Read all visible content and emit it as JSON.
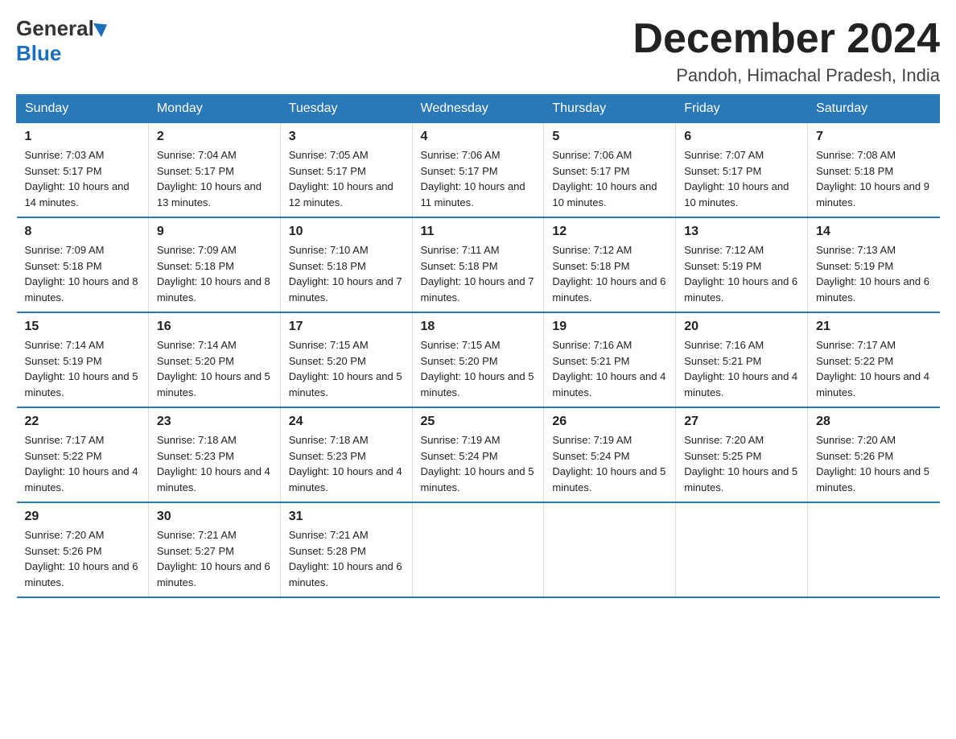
{
  "logo": {
    "general": "General",
    "blue": "Blue"
  },
  "title": "December 2024",
  "subtitle": "Pandoh, Himachal Pradesh, India",
  "days_of_week": [
    "Sunday",
    "Monday",
    "Tuesday",
    "Wednesday",
    "Thursday",
    "Friday",
    "Saturday"
  ],
  "weeks": [
    [
      {
        "date": "1",
        "sunrise": "Sunrise: 7:03 AM",
        "sunset": "Sunset: 5:17 PM",
        "daylight": "Daylight: 10 hours and 14 minutes."
      },
      {
        "date": "2",
        "sunrise": "Sunrise: 7:04 AM",
        "sunset": "Sunset: 5:17 PM",
        "daylight": "Daylight: 10 hours and 13 minutes."
      },
      {
        "date": "3",
        "sunrise": "Sunrise: 7:05 AM",
        "sunset": "Sunset: 5:17 PM",
        "daylight": "Daylight: 10 hours and 12 minutes."
      },
      {
        "date": "4",
        "sunrise": "Sunrise: 7:06 AM",
        "sunset": "Sunset: 5:17 PM",
        "daylight": "Daylight: 10 hours and 11 minutes."
      },
      {
        "date": "5",
        "sunrise": "Sunrise: 7:06 AM",
        "sunset": "Sunset: 5:17 PM",
        "daylight": "Daylight: 10 hours and 10 minutes."
      },
      {
        "date": "6",
        "sunrise": "Sunrise: 7:07 AM",
        "sunset": "Sunset: 5:17 PM",
        "daylight": "Daylight: 10 hours and 10 minutes."
      },
      {
        "date": "7",
        "sunrise": "Sunrise: 7:08 AM",
        "sunset": "Sunset: 5:18 PM",
        "daylight": "Daylight: 10 hours and 9 minutes."
      }
    ],
    [
      {
        "date": "8",
        "sunrise": "Sunrise: 7:09 AM",
        "sunset": "Sunset: 5:18 PM",
        "daylight": "Daylight: 10 hours and 8 minutes."
      },
      {
        "date": "9",
        "sunrise": "Sunrise: 7:09 AM",
        "sunset": "Sunset: 5:18 PM",
        "daylight": "Daylight: 10 hours and 8 minutes."
      },
      {
        "date": "10",
        "sunrise": "Sunrise: 7:10 AM",
        "sunset": "Sunset: 5:18 PM",
        "daylight": "Daylight: 10 hours and 7 minutes."
      },
      {
        "date": "11",
        "sunrise": "Sunrise: 7:11 AM",
        "sunset": "Sunset: 5:18 PM",
        "daylight": "Daylight: 10 hours and 7 minutes."
      },
      {
        "date": "12",
        "sunrise": "Sunrise: 7:12 AM",
        "sunset": "Sunset: 5:18 PM",
        "daylight": "Daylight: 10 hours and 6 minutes."
      },
      {
        "date": "13",
        "sunrise": "Sunrise: 7:12 AM",
        "sunset": "Sunset: 5:19 PM",
        "daylight": "Daylight: 10 hours and 6 minutes."
      },
      {
        "date": "14",
        "sunrise": "Sunrise: 7:13 AM",
        "sunset": "Sunset: 5:19 PM",
        "daylight": "Daylight: 10 hours and 6 minutes."
      }
    ],
    [
      {
        "date": "15",
        "sunrise": "Sunrise: 7:14 AM",
        "sunset": "Sunset: 5:19 PM",
        "daylight": "Daylight: 10 hours and 5 minutes."
      },
      {
        "date": "16",
        "sunrise": "Sunrise: 7:14 AM",
        "sunset": "Sunset: 5:20 PM",
        "daylight": "Daylight: 10 hours and 5 minutes."
      },
      {
        "date": "17",
        "sunrise": "Sunrise: 7:15 AM",
        "sunset": "Sunset: 5:20 PM",
        "daylight": "Daylight: 10 hours and 5 minutes."
      },
      {
        "date": "18",
        "sunrise": "Sunrise: 7:15 AM",
        "sunset": "Sunset: 5:20 PM",
        "daylight": "Daylight: 10 hours and 5 minutes."
      },
      {
        "date": "19",
        "sunrise": "Sunrise: 7:16 AM",
        "sunset": "Sunset: 5:21 PM",
        "daylight": "Daylight: 10 hours and 4 minutes."
      },
      {
        "date": "20",
        "sunrise": "Sunrise: 7:16 AM",
        "sunset": "Sunset: 5:21 PM",
        "daylight": "Daylight: 10 hours and 4 minutes."
      },
      {
        "date": "21",
        "sunrise": "Sunrise: 7:17 AM",
        "sunset": "Sunset: 5:22 PM",
        "daylight": "Daylight: 10 hours and 4 minutes."
      }
    ],
    [
      {
        "date": "22",
        "sunrise": "Sunrise: 7:17 AM",
        "sunset": "Sunset: 5:22 PM",
        "daylight": "Daylight: 10 hours and 4 minutes."
      },
      {
        "date": "23",
        "sunrise": "Sunrise: 7:18 AM",
        "sunset": "Sunset: 5:23 PM",
        "daylight": "Daylight: 10 hours and 4 minutes."
      },
      {
        "date": "24",
        "sunrise": "Sunrise: 7:18 AM",
        "sunset": "Sunset: 5:23 PM",
        "daylight": "Daylight: 10 hours and 4 minutes."
      },
      {
        "date": "25",
        "sunrise": "Sunrise: 7:19 AM",
        "sunset": "Sunset: 5:24 PM",
        "daylight": "Daylight: 10 hours and 5 minutes."
      },
      {
        "date": "26",
        "sunrise": "Sunrise: 7:19 AM",
        "sunset": "Sunset: 5:24 PM",
        "daylight": "Daylight: 10 hours and 5 minutes."
      },
      {
        "date": "27",
        "sunrise": "Sunrise: 7:20 AM",
        "sunset": "Sunset: 5:25 PM",
        "daylight": "Daylight: 10 hours and 5 minutes."
      },
      {
        "date": "28",
        "sunrise": "Sunrise: 7:20 AM",
        "sunset": "Sunset: 5:26 PM",
        "daylight": "Daylight: 10 hours and 5 minutes."
      }
    ],
    [
      {
        "date": "29",
        "sunrise": "Sunrise: 7:20 AM",
        "sunset": "Sunset: 5:26 PM",
        "daylight": "Daylight: 10 hours and 6 minutes."
      },
      {
        "date": "30",
        "sunrise": "Sunrise: 7:21 AM",
        "sunset": "Sunset: 5:27 PM",
        "daylight": "Daylight: 10 hours and 6 minutes."
      },
      {
        "date": "31",
        "sunrise": "Sunrise: 7:21 AM",
        "sunset": "Sunset: 5:28 PM",
        "daylight": "Daylight: 10 hours and 6 minutes."
      },
      {
        "date": "",
        "sunrise": "",
        "sunset": "",
        "daylight": ""
      },
      {
        "date": "",
        "sunrise": "",
        "sunset": "",
        "daylight": ""
      },
      {
        "date": "",
        "sunrise": "",
        "sunset": "",
        "daylight": ""
      },
      {
        "date": "",
        "sunrise": "",
        "sunset": "",
        "daylight": ""
      }
    ]
  ]
}
